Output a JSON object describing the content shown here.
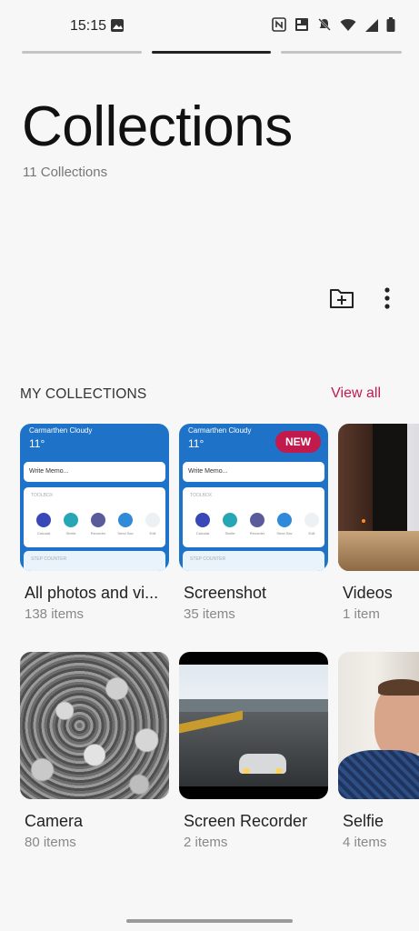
{
  "status": {
    "time": "15:15"
  },
  "header": {
    "title": "Collections",
    "subtitle": "11 Collections"
  },
  "section": {
    "title": "MY COLLECTIONS",
    "view_all": "View all"
  },
  "collections": [
    {
      "name": "All photos and vi...",
      "count": "138 items"
    },
    {
      "name": "Screenshot",
      "count": "35 items",
      "badge": "NEW"
    },
    {
      "name": "Videos",
      "count": "1 item"
    },
    {
      "name": "Camera",
      "count": "80 items"
    },
    {
      "name": "Screen Recorder",
      "count": "2 items"
    },
    {
      "name": "Selfie",
      "count": "4 items"
    }
  ],
  "screenshot_thumb": {
    "weather": "Carmarthen  Cloudy",
    "temp": "11°",
    "memo": "Write Memo...",
    "toolbox": "TOOLBOX",
    "tools": [
      "Calculat",
      "Shelle",
      "Recorder",
      "Send Sav",
      "Edit"
    ],
    "step": "STEP COUNTER"
  },
  "icons": {
    "add_folder": "add-folder-icon",
    "more": "more-vertical-icon"
  },
  "colors": {
    "accent": "#c21a4d",
    "widget_blue": "#1e73c8"
  }
}
